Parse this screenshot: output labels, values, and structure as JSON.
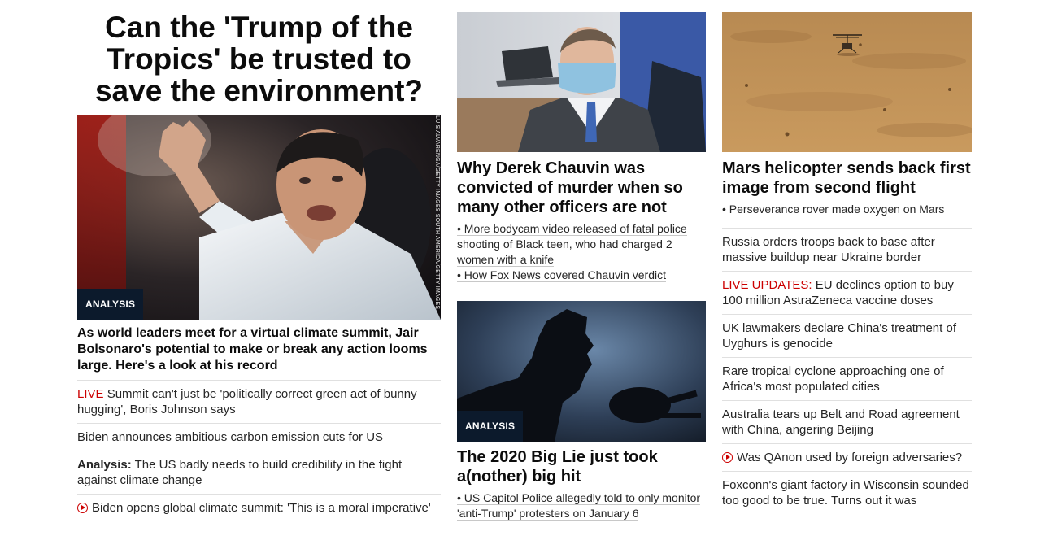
{
  "col1": {
    "title": "Can the 'Trump of the Tropics' be trusted to save the environment?",
    "image_badge": "ANALYSIS",
    "image_credit": "LUIS ALVARENGA/GETTY IMAGES SOUTH AMERICA/GETTY IMAGES",
    "lede": "As world leaders meet for a virtual climate summit, Jair Bolsonaro's potential to make or break any action looms large. Here's a look at his record",
    "items": [
      {
        "prefix": "LIVE",
        "text": " Summit can't just be 'politically correct green act of bunny hugging', Boris Johnson says"
      },
      {
        "text": "Biden announces ambitious carbon emission cuts for US"
      },
      {
        "prefix": "Analysis:",
        "text": " The US badly needs to build credibility in the fight against climate change"
      },
      {
        "icon": "play-icon",
        "text": "Biden opens global climate summit: 'This is a moral imperative'"
      }
    ]
  },
  "col2": {
    "story1": {
      "headline": "Why Derek Chauvin was convicted of murder when so many other officers are not",
      "bullets": [
        {
          "line1": "• More bodycam video released of fatal police",
          "line2": "shooting of Black teen, who had charged 2",
          "line3": "women with a knife"
        },
        {
          "line1": "• How Fox News covered Chauvin verdict"
        }
      ]
    },
    "story2": {
      "image_badge": "ANALYSIS",
      "headline": "The 2020 Big Lie just took a(nother) big hit",
      "bullets": [
        {
          "line1": "• US Capitol Police allegedly told to only monitor",
          "line2": "'anti-Trump' protesters on January 6"
        }
      ]
    }
  },
  "col3": {
    "headline": "Mars helicopter sends back first image from second flight",
    "bullet": "• Perseverance rover made oxygen on Mars",
    "items": [
      {
        "text": "Russia orders troops back to base after massive buildup near Ukraine border"
      },
      {
        "prefix": "LIVE UPDATES:",
        "text": " EU declines option to buy 100 million AstraZeneca vaccine doses"
      },
      {
        "text": "UK lawmakers declare China's treatment of Uyghurs is genocide"
      },
      {
        "text": "Rare tropical cyclone approaching one of Africa's most populated cities"
      },
      {
        "text": "Australia tears up Belt and Road agreement with China, angering Beijing"
      },
      {
        "icon": "play-icon",
        "text": "Was QAnon used by foreign adversaries?"
      },
      {
        "text": "Foxconn's giant factory in Wisconsin sounded too good to be true. Turns out it was"
      }
    ]
  },
  "colors": {
    "live_red": "#cc0000",
    "badge_bg": "#0c1a2c",
    "rule": "#e0e0e0"
  }
}
